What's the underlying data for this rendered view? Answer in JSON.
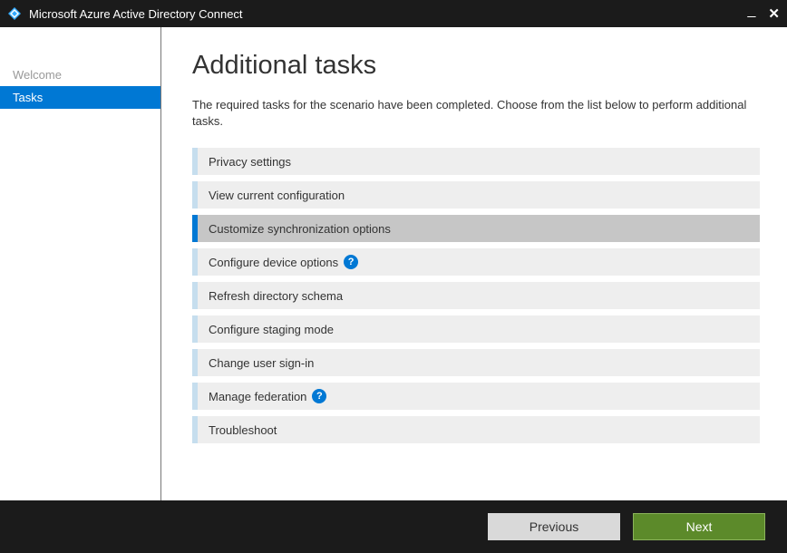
{
  "titlebar": {
    "title": "Microsoft Azure Active Directory Connect"
  },
  "sidebar": {
    "items": [
      {
        "label": "Welcome",
        "active": false
      },
      {
        "label": "Tasks",
        "active": true
      }
    ]
  },
  "main": {
    "title": "Additional tasks",
    "description": "The required tasks for the scenario have been completed. Choose from the list below to perform additional tasks.",
    "tasks": [
      {
        "label": "Privacy settings",
        "selected": false,
        "help": false
      },
      {
        "label": "View current configuration",
        "selected": false,
        "help": false
      },
      {
        "label": "Customize synchronization options",
        "selected": true,
        "help": false
      },
      {
        "label": "Configure device options",
        "selected": false,
        "help": true
      },
      {
        "label": "Refresh directory schema",
        "selected": false,
        "help": false
      },
      {
        "label": "Configure staging mode",
        "selected": false,
        "help": false
      },
      {
        "label": "Change user sign-in",
        "selected": false,
        "help": false
      },
      {
        "label": "Manage federation",
        "selected": false,
        "help": true
      },
      {
        "label": "Troubleshoot",
        "selected": false,
        "help": false
      }
    ]
  },
  "footer": {
    "previous_label": "Previous",
    "next_label": "Next"
  }
}
